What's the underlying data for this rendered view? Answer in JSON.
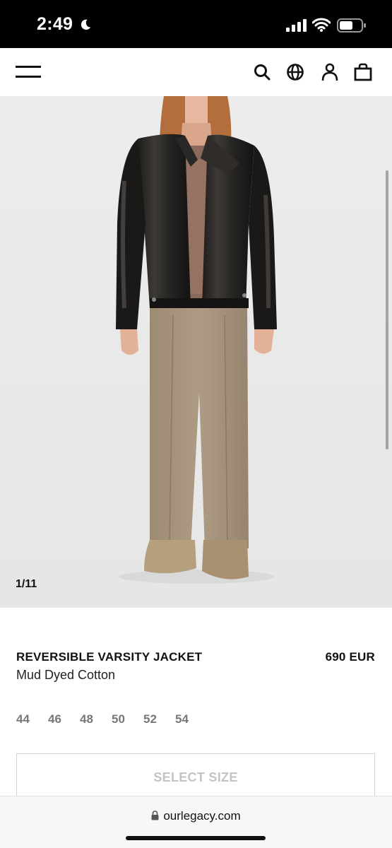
{
  "status_bar": {
    "time": "2:49"
  },
  "nav": {
    "icons": [
      "menu-icon",
      "search-icon",
      "globe-icon",
      "account-icon",
      "bag-icon"
    ]
  },
  "product": {
    "image_counter": "1/11",
    "name": "REVERSIBLE VARSITY JACKET",
    "subtitle": "Mud Dyed Cotton",
    "price": "690 EUR",
    "sizes": [
      "44",
      "46",
      "48",
      "50",
      "52",
      "54"
    ],
    "select_size_label": "SELECT SIZE"
  },
  "browser": {
    "url": "ourlegacy.com"
  },
  "colors": {
    "text": "#111111",
    "muted": "#777777",
    "disabled": "#c4c4c4",
    "image_bg": "#ebebeb"
  }
}
